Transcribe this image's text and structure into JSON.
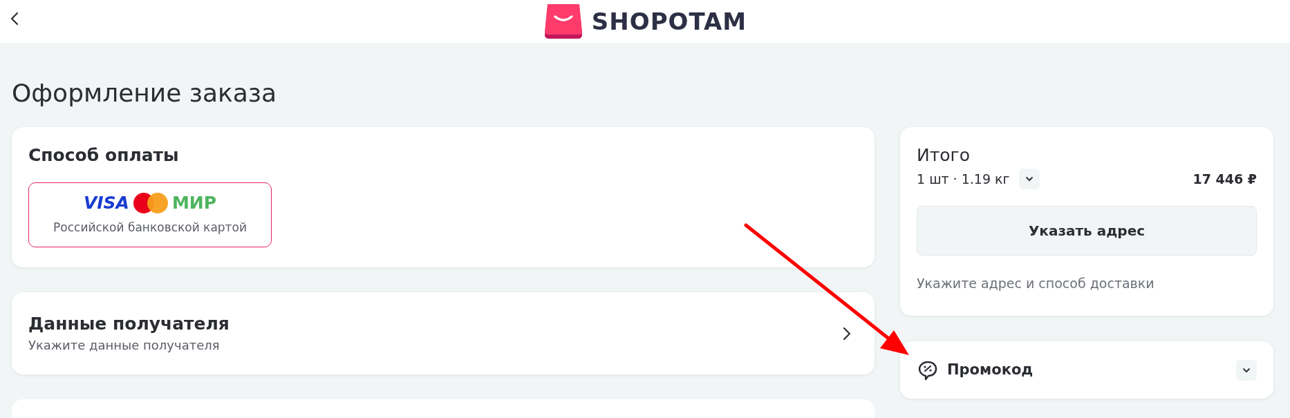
{
  "header": {
    "logo_text": "SHOPOTAM"
  },
  "page_title": "Оформление заказа",
  "payment": {
    "title": "Способ оплаты",
    "options": [
      {
        "brands": [
          "VISA",
          "МИР"
        ],
        "label": "Российской банковской картой",
        "selected": true
      }
    ]
  },
  "recipient": {
    "title": "Данные получателя",
    "subtitle": "Укажите данные получателя"
  },
  "summary": {
    "title": "Итого",
    "details": "1 шт · 1.19 кг",
    "expanded": false,
    "total": "17 446 ₽",
    "button": "Указать адрес",
    "hint": "Укажите адрес и способ доставки"
  },
  "promo": {
    "title": "Промокод",
    "expanded": false
  }
}
